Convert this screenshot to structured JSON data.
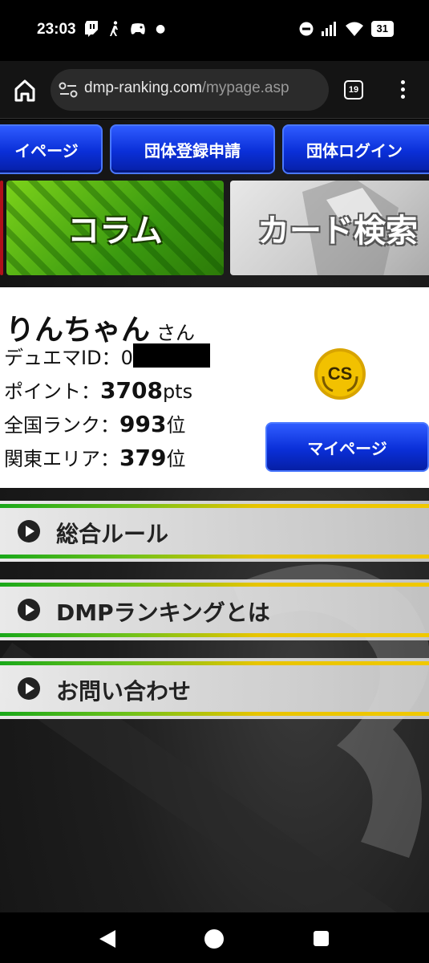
{
  "status_bar": {
    "time": "23:03",
    "battery": "31",
    "left_icons": [
      "twitch-icon",
      "walk-icon",
      "game-controller-icon",
      "dot-icon"
    ],
    "right_icons": [
      "do-not-disturb-icon",
      "signal-icon",
      "wifi-icon",
      "battery-icon"
    ]
  },
  "browser": {
    "url_host": "dmp-ranking.com",
    "url_path": "/mypage.asp",
    "tab_count": "19"
  },
  "nav": {
    "mypage_partial": "イページ",
    "group_register": "団体登録申請",
    "group_login": "団体ログイン"
  },
  "banners": {
    "column": "コラム",
    "card_search": "カード検索"
  },
  "profile": {
    "name": "りんちゃん",
    "suffix": "さん",
    "duema_id_label": "デュエマID：",
    "duema_id_value": "0",
    "points_label": "ポイント：",
    "points_value": "3708",
    "points_unit": "pts",
    "national_rank_label": "全国ランク：",
    "national_rank_value": "993",
    "rank_unit": "位",
    "area_rank_label": "関東エリア：",
    "area_rank_value": "379",
    "badge_text": "CS",
    "mypage_button": "マイページ"
  },
  "menu": {
    "items": [
      {
        "label": "総合ルール"
      },
      {
        "label": "DMPランキングとは"
      },
      {
        "label": "お問い合わせ"
      }
    ]
  },
  "colors": {
    "nav_button": "#0a2fd8",
    "column_banner": "#4aa814",
    "menu_stripe_green": "#1aa81a",
    "menu_stripe_yellow": "#f0c800",
    "badge_gold": "#f2c100"
  }
}
